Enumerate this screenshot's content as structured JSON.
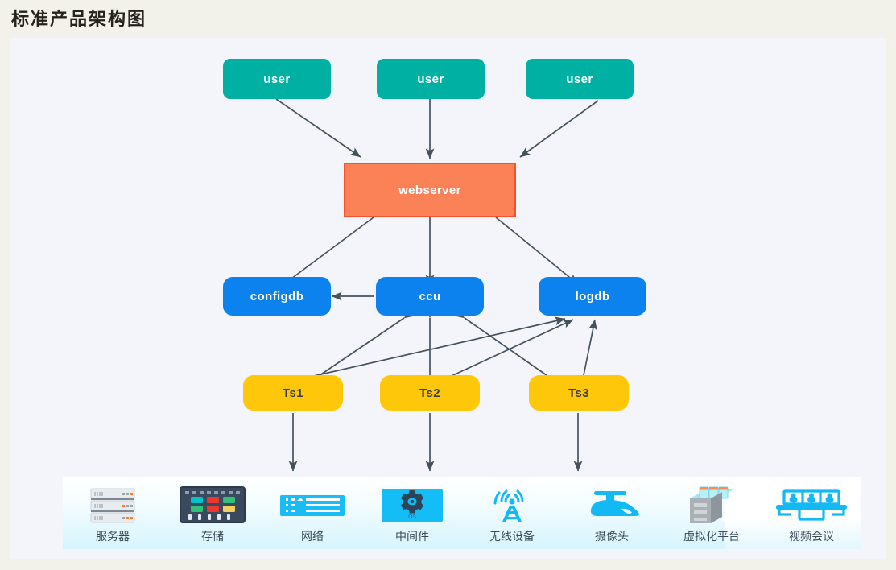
{
  "page": {
    "title": "标准产品架构图",
    "background_color": "#f2f1ea",
    "canvas_color": "#f4f5fa"
  },
  "colors": {
    "user_node": "#00b0a2",
    "webserver_fill": "#fb8256",
    "webserver_border": "#f4512c",
    "db_node": "#0c82ee",
    "ts_node": "#ffc709",
    "arrow": "#44525e",
    "device_icon": "#1ec0f5",
    "device_label": "#3c4a5a"
  },
  "diagram": {
    "tier_users": [
      {
        "id": "user-1",
        "label": "user"
      },
      {
        "id": "user-2",
        "label": "user"
      },
      {
        "id": "user-3",
        "label": "user"
      }
    ],
    "tier_web": [
      {
        "id": "webserver",
        "label": "webserver"
      }
    ],
    "tier_services": [
      {
        "id": "configdb",
        "label": "configdb"
      },
      {
        "id": "ccu",
        "label": "ccu"
      },
      {
        "id": "logdb",
        "label": "logdb"
      }
    ],
    "tier_ts": [
      {
        "id": "ts1",
        "label": "Ts1"
      },
      {
        "id": "ts2",
        "label": "Ts2"
      },
      {
        "id": "ts3",
        "label": "Ts3"
      }
    ],
    "edges": [
      {
        "from": "user-1",
        "to": "webserver",
        "direction": "one-way"
      },
      {
        "from": "user-2",
        "to": "webserver",
        "direction": "one-way"
      },
      {
        "from": "user-3",
        "to": "webserver",
        "direction": "one-way"
      },
      {
        "from": "webserver",
        "to": "configdb",
        "direction": "two-way"
      },
      {
        "from": "webserver",
        "to": "ccu",
        "direction": "one-way"
      },
      {
        "from": "webserver",
        "to": "logdb",
        "direction": "one-way"
      },
      {
        "from": "ccu",
        "to": "configdb",
        "direction": "one-way"
      },
      {
        "from": "ccu",
        "to": "ts1",
        "direction": "two-way"
      },
      {
        "from": "ccu",
        "to": "ts2",
        "direction": "two-way"
      },
      {
        "from": "ccu",
        "to": "ts3",
        "direction": "two-way"
      },
      {
        "from": "ts1",
        "to": "logdb",
        "direction": "one-way"
      },
      {
        "from": "ts2",
        "to": "logdb",
        "direction": "one-way"
      },
      {
        "from": "ts3",
        "to": "logdb",
        "direction": "one-way"
      },
      {
        "from": "ts1",
        "to": "device-bar",
        "direction": "one-way"
      },
      {
        "from": "ts2",
        "to": "device-bar",
        "direction": "one-way"
      },
      {
        "from": "ts3",
        "to": "device-bar",
        "direction": "one-way"
      }
    ]
  },
  "devices": [
    {
      "id": "server",
      "label": "服务器",
      "icon": "server-stack-icon"
    },
    {
      "id": "storage",
      "label": "存储",
      "icon": "storage-array-icon"
    },
    {
      "id": "network",
      "label": "网络",
      "icon": "network-switch-icon"
    },
    {
      "id": "middleware",
      "label": "中间件",
      "icon": "gear-os-icon",
      "badge": "OS"
    },
    {
      "id": "wireless",
      "label": "无线设备",
      "icon": "wireless-antenna-icon"
    },
    {
      "id": "camera",
      "label": "摄像头",
      "icon": "dome-camera-icon"
    },
    {
      "id": "virtualization",
      "label": "虚拟化平台",
      "icon": "virtual-platform-icon"
    },
    {
      "id": "video",
      "label": "视频会议",
      "icon": "video-conference-icon"
    }
  ]
}
